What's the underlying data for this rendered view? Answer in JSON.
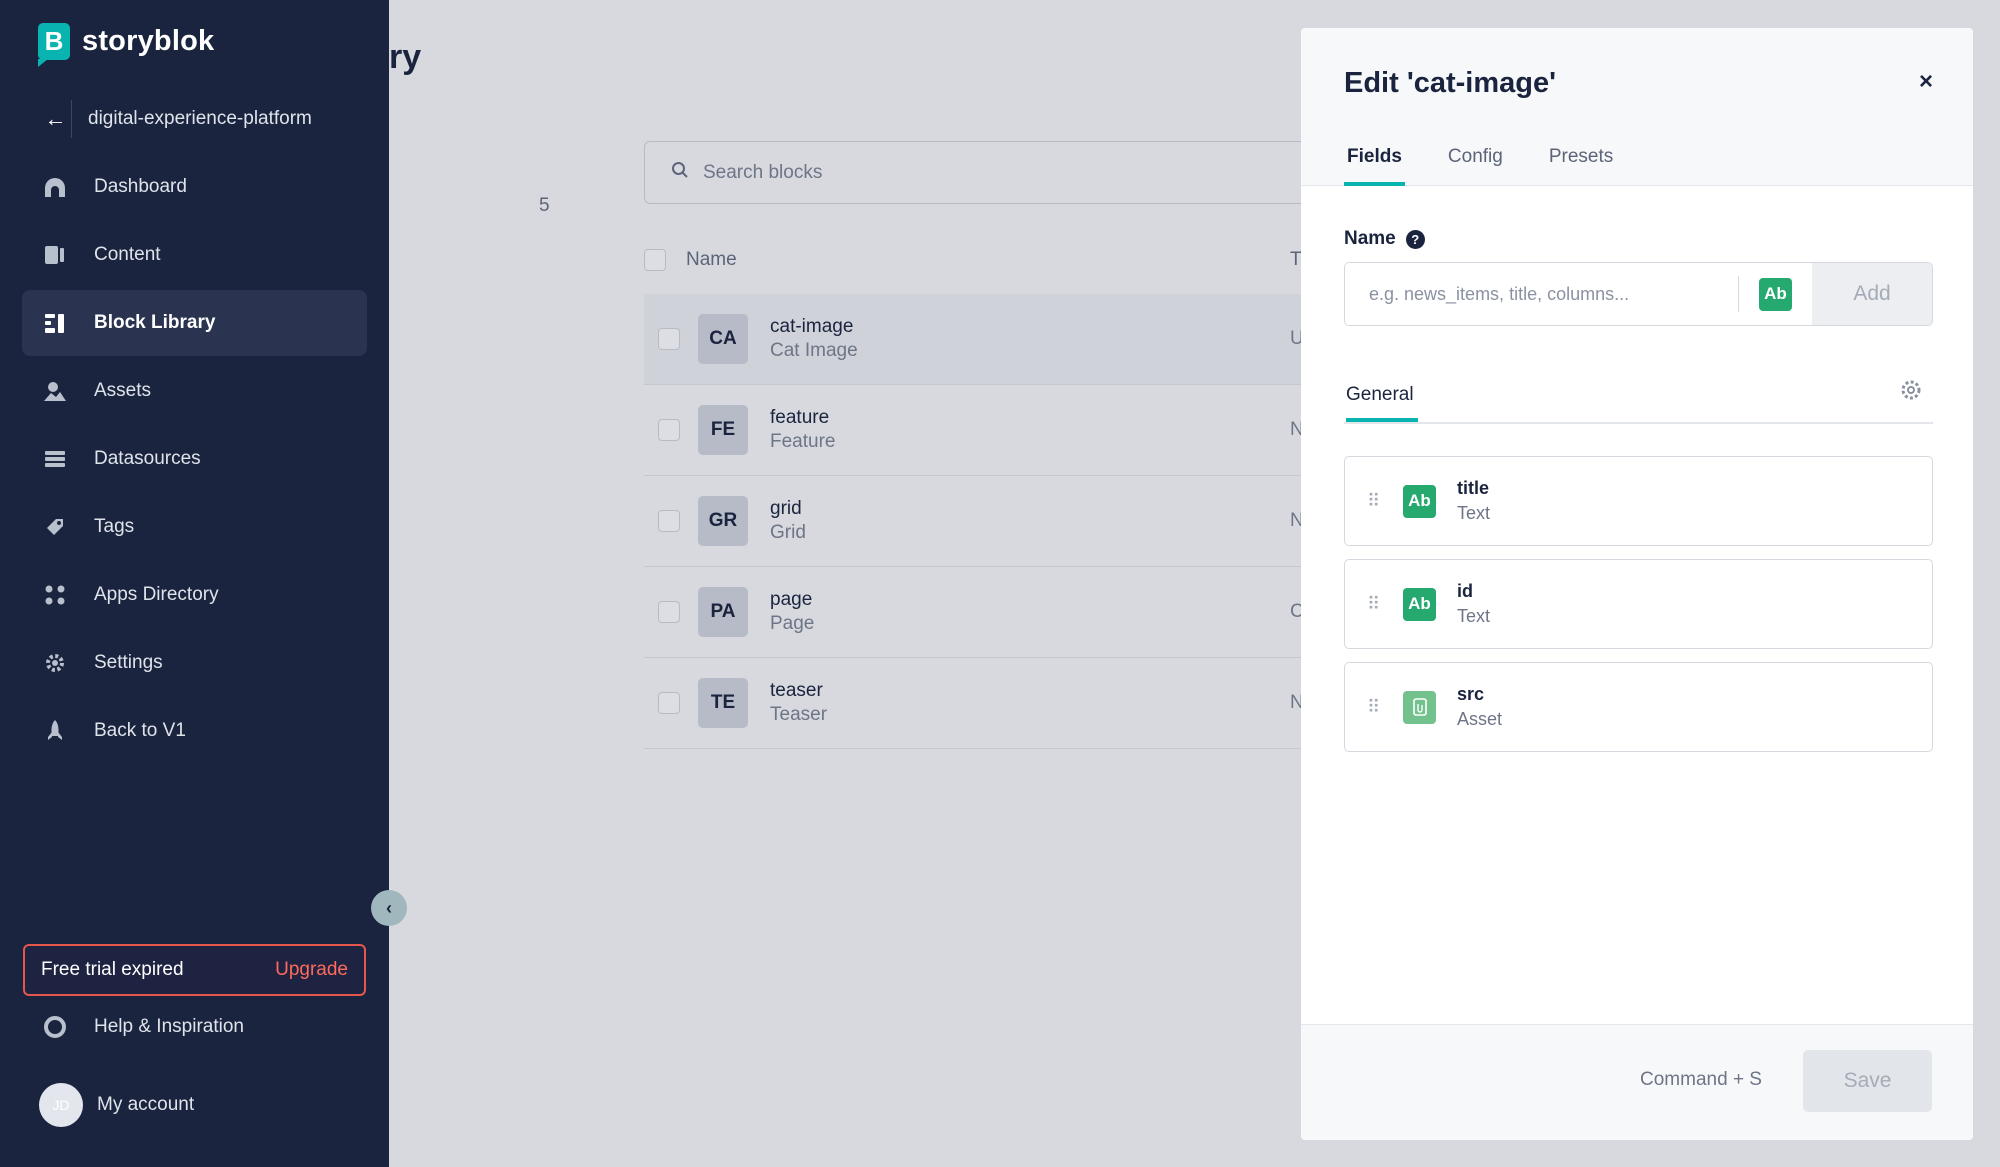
{
  "brand": {
    "name": "storyblok",
    "logo_letter": "B"
  },
  "sidebar": {
    "space_name": "digital-experience-platform",
    "items": [
      {
        "label": "Dashboard",
        "icon": "dashboard-icon"
      },
      {
        "label": "Content",
        "icon": "content-icon"
      },
      {
        "label": "Block Library",
        "icon": "block-library-icon",
        "active": true
      },
      {
        "label": "Assets",
        "icon": "assets-icon"
      },
      {
        "label": "Datasources",
        "icon": "datasources-icon"
      },
      {
        "label": "Tags",
        "icon": "tags-icon"
      },
      {
        "label": "Apps Directory",
        "icon": "apps-icon"
      },
      {
        "label": "Settings",
        "icon": "gear-icon"
      },
      {
        "label": "Back to V1",
        "icon": "rocket-icon"
      }
    ],
    "trial": {
      "label": "Free trial expired",
      "upgrade": "Upgrade"
    },
    "help_label": "Help & Inspiration",
    "account": {
      "label": "My account",
      "initials": "JD"
    }
  },
  "library": {
    "title_fragment": "ry",
    "count": "5",
    "search_placeholder": "Search blocks",
    "columns": {
      "name": "Name",
      "type": "T"
    },
    "rows": [
      {
        "badge": "CA",
        "name": "cat-image",
        "display": "Cat Image",
        "type": "U"
      },
      {
        "badge": "FE",
        "name": "feature",
        "display": "Feature",
        "type": "N"
      },
      {
        "badge": "GR",
        "name": "grid",
        "display": "Grid",
        "type": "N"
      },
      {
        "badge": "PA",
        "name": "page",
        "display": "Page",
        "type": "C"
      },
      {
        "badge": "TE",
        "name": "teaser",
        "display": "Teaser",
        "type": "N"
      }
    ]
  },
  "panel": {
    "title": "Edit 'cat-image'",
    "close": "×",
    "tabs": [
      "Fields",
      "Config",
      "Presets"
    ],
    "name_label": "Name",
    "name_help": "?",
    "name_placeholder": "e.g. news_items, title, columns...",
    "type_badge": "Ab",
    "add_label": "Add",
    "group_name": "General",
    "fields": [
      {
        "name": "title",
        "type": "Text",
        "badge": "Ab"
      },
      {
        "name": "id",
        "type": "Text",
        "badge": "Ab"
      },
      {
        "name": "src",
        "type": "Asset",
        "badge": "asset"
      }
    ],
    "shortcut": "Command + S",
    "save_label": "Save"
  },
  "colors": {
    "sidebar_bg": "#1b243f",
    "accent": "#09b3af",
    "text_badge": "#25a96f",
    "upgrade": "#ff6a5c"
  }
}
